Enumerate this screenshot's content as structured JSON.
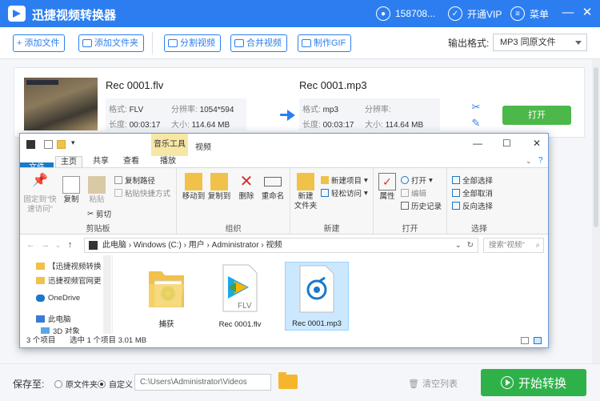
{
  "app": {
    "title": "迅捷视频转换器",
    "account": "158708...",
    "vip": "开通VIP",
    "menu": "菜单"
  },
  "toolbar": {
    "add_file": "+ 添加文件",
    "add_folder": "添加文件夹",
    "split": "分割视频",
    "merge": "合并视频",
    "gif": "制作GIF",
    "format_label": "输出格式:",
    "format_value": "MP3  同原文件"
  },
  "task": {
    "src_name": "Rec 0001.flv",
    "src_format_k": "格式:",
    "src_format_v": "FLV",
    "src_res_k": "分辨率:",
    "src_res_v": "1054*594",
    "src_dur_k": "长度:",
    "src_dur_v": "00:03:17",
    "src_size_k": "大小:",
    "src_size_v": "114.64 MB",
    "dst_name": "Rec 0001.mp3",
    "dst_format_k": "格式:",
    "dst_format_v": "mp3",
    "dst_res_k": "分辨率:",
    "dst_res_v": "",
    "dst_dur_k": "长度:",
    "dst_dur_v": "00:03:17",
    "dst_size_k": "大小:",
    "dst_size_v": "114.64 MB",
    "open": "打开"
  },
  "bottom": {
    "save_label": "保存至:",
    "opt_source": "原文件夹",
    "opt_custom": "自定义",
    "path": "C:\\Users\\Administrator\\Videos",
    "clear": "清空列表",
    "start": "开始转换"
  },
  "explorer": {
    "music_tools": "音乐工具",
    "window_title": "视频",
    "tabs": [
      "文件",
      "主页",
      "共享",
      "查看",
      "播放"
    ],
    "ribbon": {
      "pin": "固定到\"快\n速访问\"",
      "copy": "复制",
      "paste": "粘贴",
      "copy_path": "复制路径",
      "paste_shortcut": "粘贴快捷方式",
      "cut": "剪切",
      "group_clipboard": "剪贴板",
      "move_to": "移动到",
      "copy_to": "复制到",
      "delete": "删除",
      "rename": "重命名",
      "group_organize": "组织",
      "new_folder": "新建\n文件夹",
      "new_item": "新建项目",
      "easy_access": "轻松访问",
      "group_new": "新建",
      "properties": "属性",
      "open": "打开",
      "edit": "编辑",
      "history": "历史记录",
      "group_open": "打开",
      "select_all": "全部选择",
      "select_none": "全部取消",
      "invert": "反向选择",
      "group_select": "选择"
    },
    "address": "此电脑  ›  Windows (C:)  ›  用户  ›  Administrator  ›  视频",
    "search": "搜索\"视频\"",
    "nav": [
      "【迅捷视频转换",
      "迅捷视频官网更",
      "OneDrive",
      "此电脑",
      "3D 对象"
    ],
    "files": [
      {
        "name": "捕获",
        "icon": "folder-icon"
      },
      {
        "name": "Rec 0001.flv",
        "icon": "video-file-icon"
      },
      {
        "name": "Rec 0001.mp3",
        "icon": "audio-file-icon"
      }
    ],
    "status_count": "3 个项目",
    "status_selected": "选中 1 个项目  3.01 MB"
  },
  "colors": {
    "brand": "#2c7ef0",
    "start": "#2fb14a",
    "open": "#4cb84a"
  }
}
